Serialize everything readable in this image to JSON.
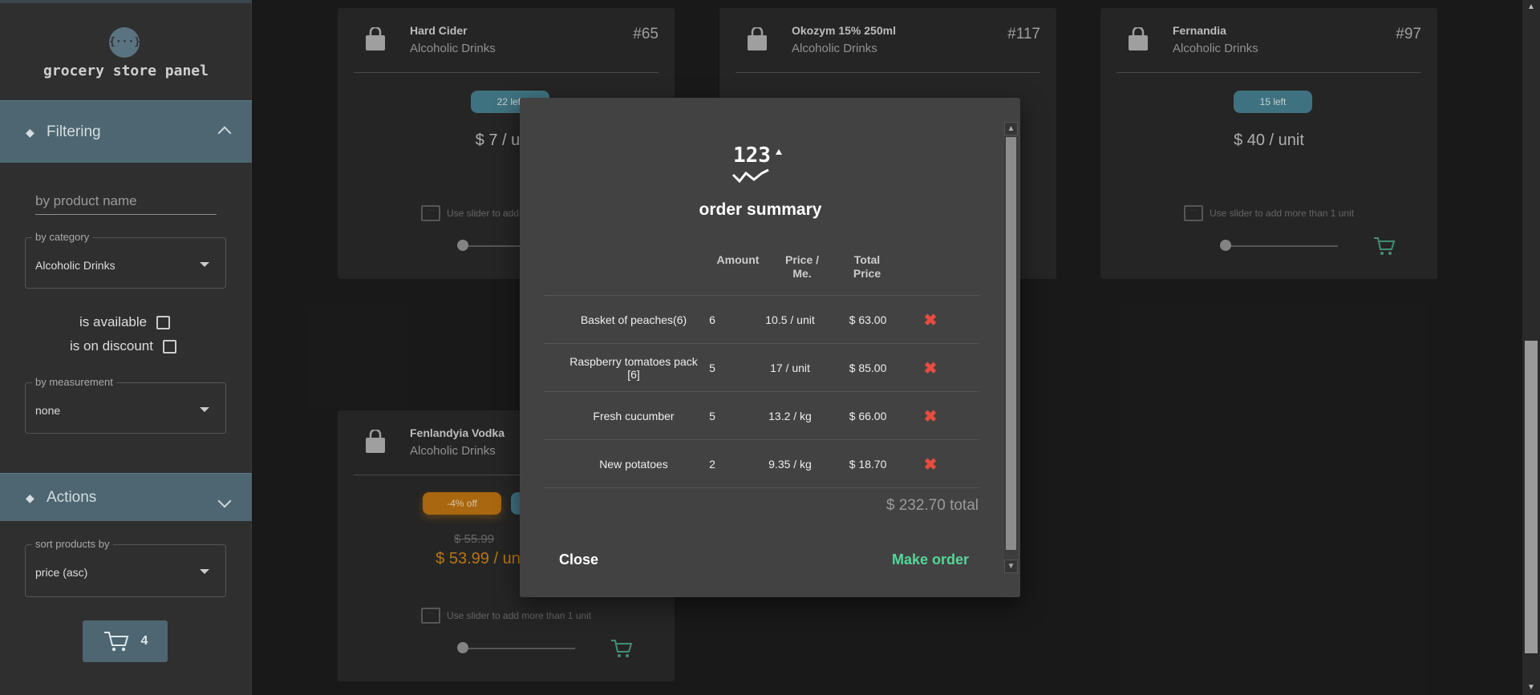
{
  "sidebar": {
    "logo_text": "{···}",
    "brand": "grocery store panel",
    "filtering_label": "Filtering",
    "name_placeholder": "by product name",
    "category_legend": "by category",
    "category_value": "Alcoholic Drinks",
    "is_available": "is available",
    "is_on_discount": "is on discount",
    "measurement_legend": "by measurement",
    "measurement_value": "none",
    "actions_label": "Actions",
    "sort_legend": "sort products by",
    "sort_value": "price (asc)",
    "cart_count": "4"
  },
  "cards": [
    {
      "name": "Hard Cider",
      "category": "Alcoholic Drinks",
      "id": "#65",
      "stock": "22 left",
      "price": "$ 7 / unit",
      "hint": "Use slider to add more than 1 unit"
    },
    {
      "name": "Okozym 15% 250ml",
      "category": "Alcoholic Drinks",
      "id": "#117"
    },
    {
      "name": "Fernandia",
      "category": "Alcoholic Drinks",
      "id": "#97",
      "stock": "15 left",
      "price": "$ 40 / unit",
      "hint": "Use slider to add more than 1 unit"
    },
    {
      "name": "Fenlandyia Vodka",
      "category": "Alcoholic Drinks",
      "discount": "-4% off",
      "old_price": "$ 55.99",
      "price": "$ 53.99 / unit",
      "hint": "Use slider to add more than 1 unit"
    }
  ],
  "modal": {
    "icon_text": "123",
    "title": "order summary",
    "headers": {
      "amount": "Amount",
      "price_per": "Price / Me.",
      "total": "Total Price"
    },
    "rows": [
      {
        "name": "Basket of peaches(6)",
        "amount": "6",
        "price_per": "10.5 / unit",
        "total": "$ 63.00"
      },
      {
        "name": "Raspberry tomatoes pack [6]",
        "amount": "5",
        "price_per": "17 / unit",
        "total": "$ 85.00"
      },
      {
        "name": "Fresh cucumber",
        "amount": "5",
        "price_per": "13.2 / kg",
        "total": "$ 66.00"
      },
      {
        "name": "New potatoes",
        "amount": "2",
        "price_per": "9.35 / kg",
        "total": "$ 18.70"
      }
    ],
    "grand_total": "$ 232.70 total",
    "close_label": "Close",
    "order_label": "Make order"
  },
  "colors": {
    "accent": "#4d6671",
    "success": "#56d59a",
    "danger": "#e74c3c",
    "discount": "#c77a12"
  }
}
